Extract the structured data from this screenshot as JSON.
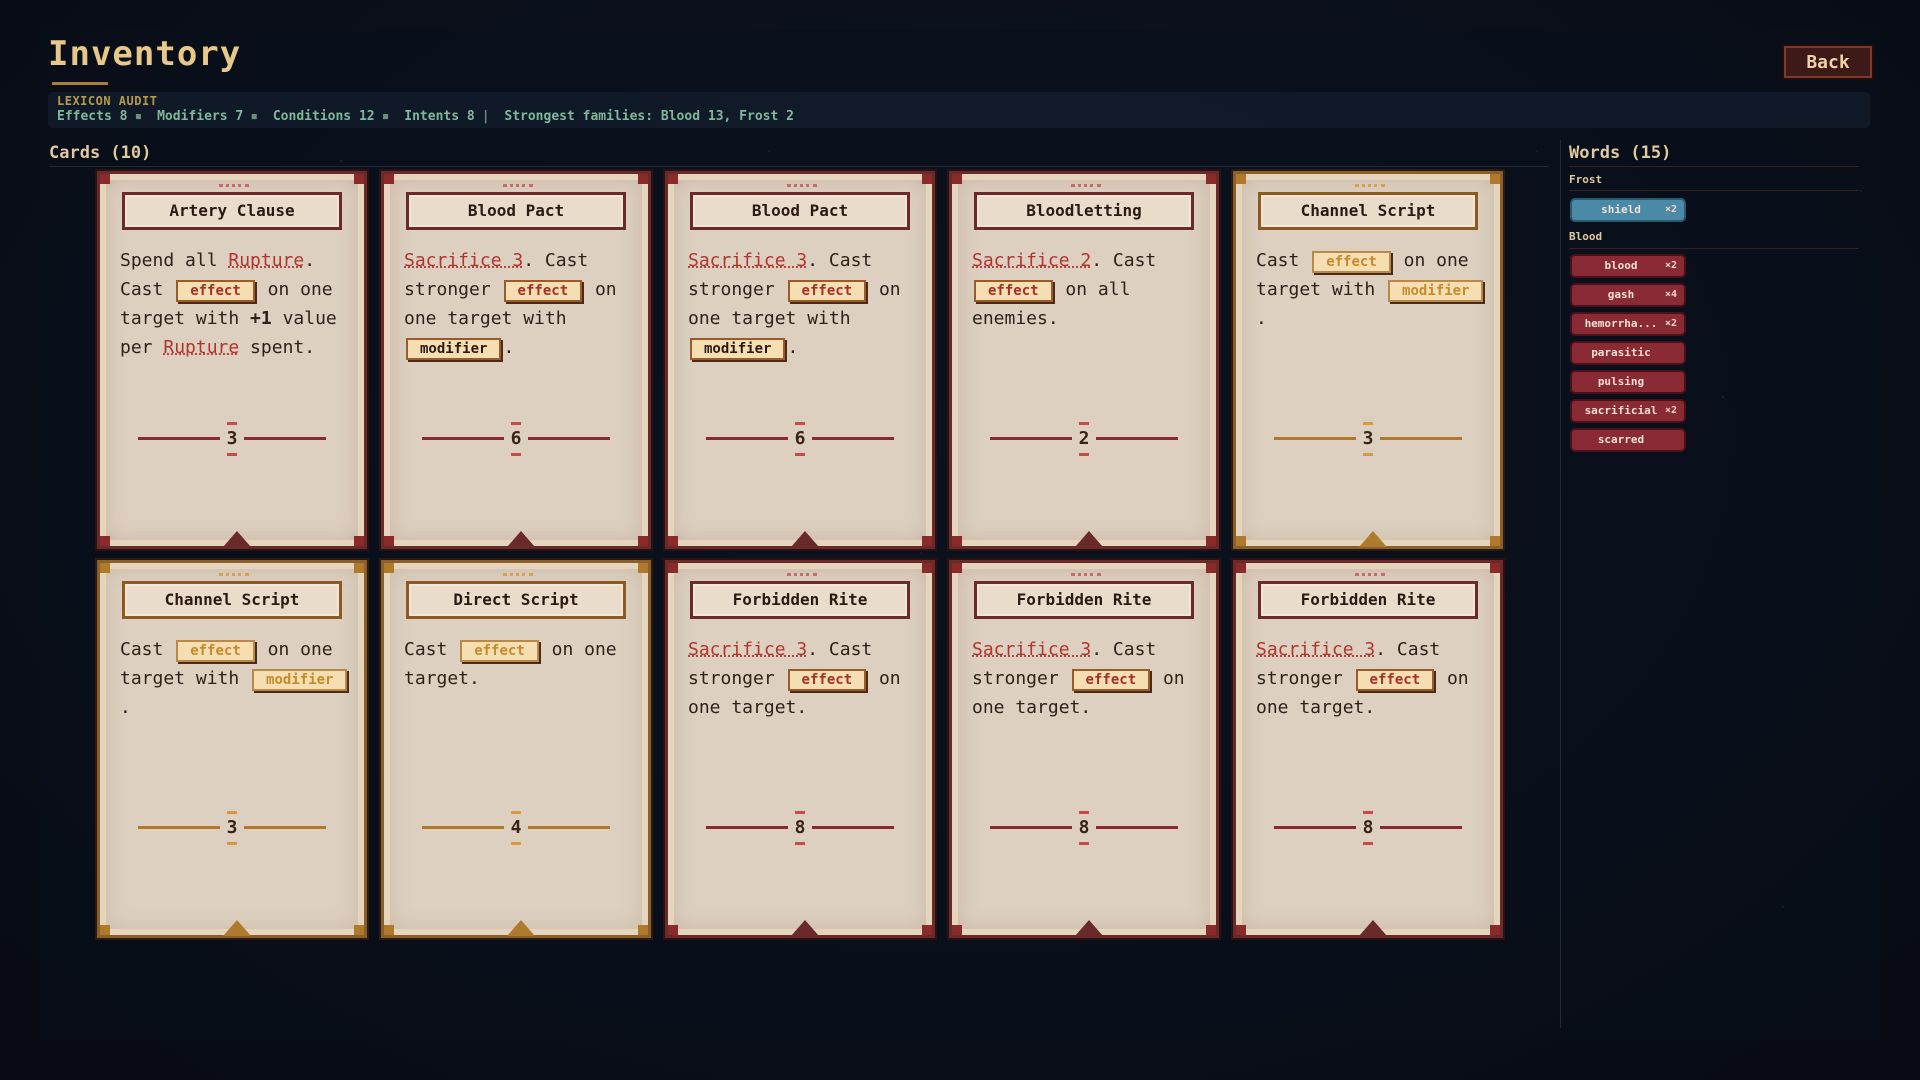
{
  "header": {
    "title": "Inventory",
    "back_label": "Back"
  },
  "audit": {
    "heading": "LEXICON AUDIT",
    "effects": "Effects 8",
    "modifiers": "Modifiers 7",
    "conditions": "Conditions 12",
    "intents": "Intents 8",
    "families": "Strongest families: Blood 13, Frost 2"
  },
  "cards_section": {
    "heading": "Cards (10)"
  },
  "cards": [
    {
      "title": "Artery Clause",
      "cost": "3",
      "family": "blood"
    },
    {
      "title": "Blood Pact",
      "cost": "6",
      "family": "blood"
    },
    {
      "title": "Blood Pact",
      "cost": "6",
      "family": "blood"
    },
    {
      "title": "Bloodletting",
      "cost": "2",
      "family": "blood"
    },
    {
      "title": "Channel Script",
      "cost": "3",
      "family": "gold"
    },
    {
      "title": "Channel Script",
      "cost": "3",
      "family": "gold"
    },
    {
      "title": "Direct Script",
      "cost": "4",
      "family": "gold"
    },
    {
      "title": "Forbidden Rite",
      "cost": "8",
      "family": "blood"
    },
    {
      "title": "Forbidden Rite",
      "cost": "8",
      "family": "blood"
    },
    {
      "title": "Forbidden Rite",
      "cost": "8",
      "family": "blood"
    }
  ],
  "card_text": {
    "artery": {
      "t1": "Spend all ",
      "kw1": "Rupture",
      "t2": ". Cast ",
      "slot": "effect",
      "t3": " on one target with ",
      "num": "+1",
      "t4": " value per ",
      "kw2": "Rupture",
      "t5": " spent."
    },
    "pact": {
      "kw": "Sacrifice 3",
      "t1": ". Cast stronger ",
      "slot": "effect",
      "t2": " on one target with ",
      "slot2": "modifier",
      "t3": "."
    },
    "letting": {
      "kw": "Sacrifice 2",
      "t1": ". Cast ",
      "slot": "effect",
      "t2": " on all enemies."
    },
    "channel": {
      "t1": "Cast ",
      "slot": "effect",
      "t2": " on one target with ",
      "slot2": "modifier",
      "t3": "."
    },
    "direct": {
      "t1": "Cast ",
      "slot": "effect",
      "t2": " on one target."
    },
    "rite": {
      "kw": "Sacrifice 3",
      "t1": ". Cast stronger ",
      "slot": "effect",
      "t2": " on one target."
    }
  },
  "words_section": {
    "heading": "Words (15)",
    "groups": [
      {
        "name": "Frost",
        "items": [
          {
            "label": "shield",
            "count": "×2"
          }
        ]
      },
      {
        "name": "Blood",
        "items": [
          {
            "label": "blood",
            "count": "×2"
          },
          {
            "label": "gash",
            "count": "×4"
          },
          {
            "label": "hemorrha...",
            "count": "×2"
          },
          {
            "label": "parasitic",
            "count": ""
          },
          {
            "label": "pulsing",
            "count": ""
          },
          {
            "label": "sacrificial",
            "count": "×2"
          },
          {
            "label": "scarred",
            "count": ""
          }
        ]
      }
    ]
  },
  "colors": {
    "accent_gold": "#e7c78a",
    "blood": "#8a2a34",
    "frost": "#4a8aa6",
    "audit_text": "#7fb89a"
  }
}
